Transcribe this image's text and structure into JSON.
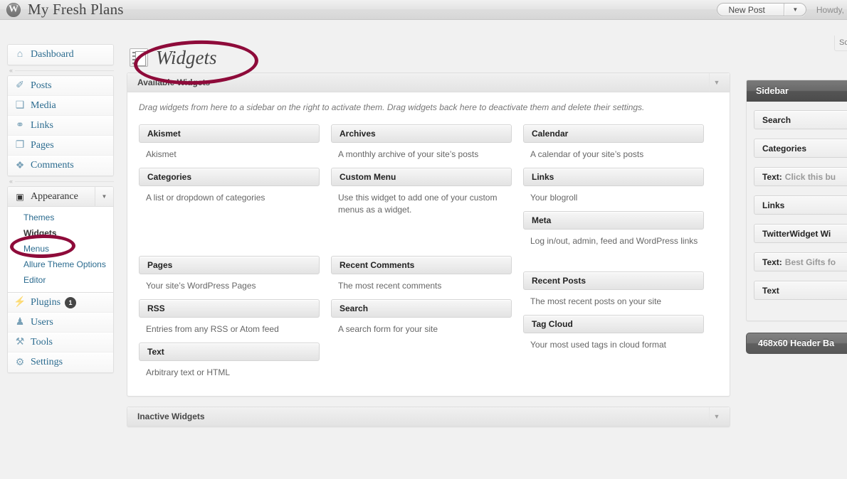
{
  "adminbar": {
    "logo_icon": "wordpress-logo-icon",
    "site_title": "My Fresh Plans",
    "new_post_label": "New Post",
    "new_post_arrow": "▼",
    "howdy": "Howdy,"
  },
  "screen_meta": {
    "screen_options_label": "Sc"
  },
  "sidebar_menu": {
    "top": [
      {
        "label": "Dashboard",
        "icon": "home-icon",
        "glyph": "⌂"
      }
    ],
    "content": [
      {
        "label": "Posts",
        "icon": "pin-icon",
        "glyph": "✐"
      },
      {
        "label": "Media",
        "icon": "media-icon",
        "glyph": "❑"
      },
      {
        "label": "Links",
        "icon": "link-icon",
        "glyph": "⚭"
      },
      {
        "label": "Pages",
        "icon": "pages-icon",
        "glyph": "❐"
      },
      {
        "label": "Comments",
        "icon": "comment-icon",
        "glyph": "❖"
      }
    ],
    "appearance": {
      "label": "Appearance",
      "icon": "appearance-icon",
      "glyph": "▣",
      "toggle_glyph": "▼",
      "submenu": [
        {
          "label": "Themes",
          "current": false
        },
        {
          "label": "Widgets",
          "current": true
        },
        {
          "label": "Menus",
          "current": false
        },
        {
          "label": "Allure Theme Options",
          "current": false
        },
        {
          "label": "Editor",
          "current": false
        }
      ]
    },
    "bottom": [
      {
        "label": "Plugins",
        "icon": "plugin-icon",
        "glyph": "⚡",
        "badge": "1"
      },
      {
        "label": "Users",
        "icon": "users-icon",
        "glyph": "♟",
        "badge": ""
      },
      {
        "label": "Tools",
        "icon": "tools-icon",
        "glyph": "⚒",
        "badge": ""
      },
      {
        "label": "Settings",
        "icon": "settings-icon",
        "glyph": "⚙",
        "badge": ""
      }
    ],
    "collapse_glyph": "«"
  },
  "page": {
    "icon": "widgets-screen-icon",
    "title": "Widgets"
  },
  "available_widgets": {
    "panel_title": "Available Widgets",
    "toggle_glyph": "▼",
    "description": "Drag widgets from here to a sidebar on the right to activate them. Drag widgets back here to deactivate them and delete their settings.",
    "columns": [
      [
        {
          "name": "Akismet",
          "desc": "Akismet",
          "gap": 0
        },
        {
          "name": "Categories",
          "desc": "A list or dropdown of categories",
          "gap": 0
        },
        {
          "name": "Pages",
          "desc": "Your site’s WordPress Pages",
          "gap": 63
        },
        {
          "name": "RSS",
          "desc": "Entries from any RSS or Atom feed",
          "gap": 0
        },
        {
          "name": "Text",
          "desc": "Arbitrary text or HTML",
          "gap": 0
        }
      ],
      [
        {
          "name": "Archives",
          "desc": "A monthly archive of your site’s posts",
          "gap": 0
        },
        {
          "name": "Custom Menu",
          "desc": "Use this widget to add one of your custom menus as a widget.",
          "gap": 0
        },
        {
          "name": "Recent Comments",
          "desc": "The most recent comments",
          "gap": 46
        },
        {
          "name": "Search",
          "desc": "A search form for your site",
          "gap": 0
        }
      ],
      [
        {
          "name": "Calendar",
          "desc": "A calendar of your site’s posts",
          "gap": 0
        },
        {
          "name": "Links",
          "desc": "Your blogroll",
          "gap": 0
        },
        {
          "name": "Meta",
          "desc": "Log in/out, admin, feed and WordPress links",
          "gap": 0
        },
        {
          "name": "Recent Posts",
          "desc": "The most recent posts on your site",
          "gap": 24
        },
        {
          "name": "Tag Cloud",
          "desc": "Your most used tags in cloud format",
          "gap": 0
        }
      ]
    ]
  },
  "inactive_widgets": {
    "panel_title": "Inactive Widgets",
    "toggle_glyph": "▼"
  },
  "widget_areas": [
    {
      "title": "Sidebar",
      "widgets": [
        {
          "name": "Search",
          "sep": "",
          "sub": ""
        },
        {
          "name": "Categories",
          "sep": "",
          "sub": ""
        },
        {
          "name": "Text",
          "sep": ":",
          "sub": "Click this bu"
        },
        {
          "name": "Links",
          "sep": "",
          "sub": ""
        },
        {
          "name": "TwitterWidget Wi",
          "sep": "",
          "sub": ""
        },
        {
          "name": "Text",
          "sep": ":",
          "sub": "Best Gifts fo"
        },
        {
          "name": "Text",
          "sep": "",
          "sub": ""
        }
      ]
    }
  ],
  "header_banner": {
    "title": "468x60 Header Ba"
  },
  "annotations": {
    "color": "#8e0b3a",
    "shapes": [
      {
        "name": "oval-around-page-title"
      },
      {
        "name": "oval-around-widgets-menu-item"
      }
    ]
  }
}
